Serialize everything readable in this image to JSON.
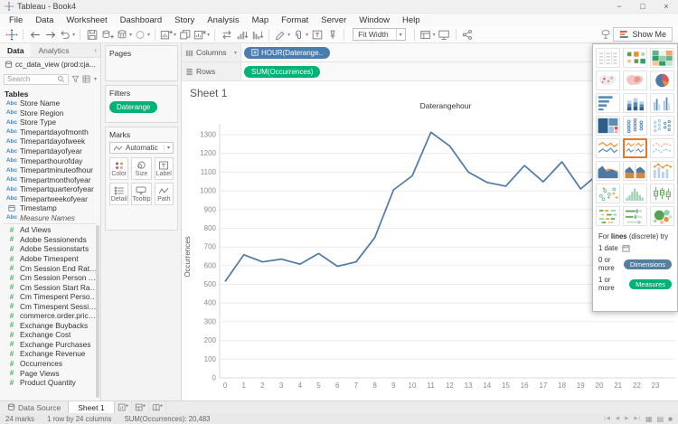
{
  "window": {
    "title": "Tableau - Book4",
    "controls": [
      {
        "name": "minimize",
        "glyph": "−"
      },
      {
        "name": "maximize",
        "glyph": "□"
      },
      {
        "name": "close",
        "glyph": "×"
      }
    ]
  },
  "glyphs": {
    "caret": "▾",
    "collapse": "‹"
  },
  "menu": {
    "items": [
      "File",
      "Data",
      "Worksheet",
      "Dashboard",
      "Story",
      "Analysis",
      "Map",
      "Format",
      "Server",
      "Window",
      "Help"
    ]
  },
  "toolbar": {
    "fit_label": "Fit Width",
    "show_me_label": "Show Me",
    "groups": [
      [
        {
          "name": "tableau-logo-button",
          "icon": "tableau-logo"
        }
      ],
      [
        {
          "name": "back-button",
          "icon": "back"
        },
        {
          "name": "forward-button",
          "icon": "forward"
        },
        {
          "name": "undo-button",
          "icon": "undo",
          "caret": true
        }
      ],
      [
        {
          "name": "save-button",
          "icon": "save"
        },
        {
          "name": "add-datasource-button",
          "icon": "add-datasource"
        },
        {
          "name": "datasource-button",
          "icon": "datasource",
          "caret": true
        },
        {
          "name": "auto-update-button",
          "icon": "auto-update",
          "caret": true
        }
      ],
      [
        {
          "name": "new-worksheet-button",
          "icon": "new-worksheet",
          "caret": true
        },
        {
          "name": "duplicate-sheet-button",
          "icon": "duplicate"
        },
        {
          "name": "clear-sheet-button",
          "icon": "clear-sheet",
          "caret": true
        }
      ],
      [
        {
          "name": "swap-axes-button",
          "icon": "swap-axes"
        },
        {
          "name": "sort-ascending-button",
          "icon": "sort-ascending"
        },
        {
          "name": "sort-descending-button",
          "icon": "sort-descending"
        }
      ],
      [
        {
          "name": "highlight-button",
          "icon": "highlight",
          "caret": true
        },
        {
          "name": "group-button",
          "icon": "group",
          "caret": true
        },
        {
          "name": "show-mark-labels-button",
          "icon": "show-mark-labels"
        },
        {
          "name": "fix-axes-button",
          "icon": "fix-axes"
        }
      ],
      [
        {
          "name": "fit-width-select",
          "type": "fit"
        }
      ],
      [
        {
          "name": "show-hide-cards-button",
          "icon": "show-hide-cards",
          "caret": true
        },
        {
          "name": "presentation-mode-button",
          "icon": "presentation"
        }
      ],
      [
        {
          "name": "share-button",
          "icon": "share"
        }
      ]
    ],
    "right": [
      {
        "name": "tooltip-balloon-button",
        "icon": "balloon"
      },
      {
        "name": "show-me-button",
        "type": "showme",
        "icon": "showme-bars"
      }
    ]
  },
  "data_pane": {
    "tabs": [
      {
        "label": "Data"
      },
      {
        "label": "Analytics"
      }
    ],
    "datasource": "cc_data_view (prod:cja...",
    "search_placeholder": "Search",
    "section_title": "Tables",
    "fields": [
      {
        "label": "Store Name",
        "type": "string"
      },
      {
        "label": "Store Region",
        "type": "string"
      },
      {
        "label": "Store Type",
        "type": "string"
      },
      {
        "label": "Timepartdayofmonth",
        "type": "string"
      },
      {
        "label": "Timepartdayofweek",
        "type": "string"
      },
      {
        "label": "Timepartdayofyear",
        "type": "string"
      },
      {
        "label": "Timeparthourofday",
        "type": "string"
      },
      {
        "label": "Timepartminuteofhour",
        "type": "string"
      },
      {
        "label": "Timepartmonthofyear",
        "type": "string"
      },
      {
        "label": "Timepartquarterofyear",
        "type": "string"
      },
      {
        "label": "Timepartweekofyear",
        "type": "string"
      },
      {
        "label": "Timestamp",
        "type": "datetime"
      },
      {
        "label": "Measure Names",
        "type": "string",
        "italic": true
      },
      {
        "label": "Ad Views",
        "type": "measure",
        "divider_before": true
      },
      {
        "label": "Adobe Sessionends",
        "type": "measure"
      },
      {
        "label": "Adobe Sessionstarts",
        "type": "measure"
      },
      {
        "label": "Adobe Timespent",
        "type": "measure"
      },
      {
        "label": "Cm Session End Rate ...",
        "type": "measure"
      },
      {
        "label": "Cm Session Person De...",
        "type": "measure"
      },
      {
        "label": "Cm Session Start Rate ...",
        "type": "measure"
      },
      {
        "label": "Cm Timespent Person ...",
        "type": "measure"
      },
      {
        "label": "Cm Timespent Session...",
        "type": "measure"
      },
      {
        "label": "commerce.order.price...",
        "type": "measure"
      },
      {
        "label": "Exchange Buybacks",
        "type": "measure"
      },
      {
        "label": "Exchange Cost",
        "type": "measure"
      },
      {
        "label": "Exchange Purchases",
        "type": "measure"
      },
      {
        "label": "Exchange Revenue",
        "type": "measure"
      },
      {
        "label": "Occurrences",
        "type": "measure"
      },
      {
        "label": "Page Views",
        "type": "measure"
      },
      {
        "label": "Product Quantity",
        "type": "measure"
      }
    ]
  },
  "cards": {
    "pages_label": "Pages",
    "filters_label": "Filters",
    "filter_pills": [
      "Daterange"
    ],
    "marks_label": "Marks",
    "mark_type": "Automatic",
    "mark_buttons": [
      {
        "label": "Color",
        "icon": "color"
      },
      {
        "label": "Size",
        "icon": "size"
      },
      {
        "label": "Label",
        "icon": "label"
      },
      {
        "label": "Detail",
        "icon": "detail"
      },
      {
        "label": "Tooltip",
        "icon": "tooltip"
      },
      {
        "label": "Path",
        "icon": "path"
      }
    ]
  },
  "shelves": {
    "columns_label": "Columns",
    "rows_label": "Rows",
    "columns_pills": [
      {
        "label": "HOUR(Daterange..",
        "color": "blue",
        "icon": "plus-box"
      }
    ],
    "rows_pills": [
      {
        "label": "SUM(Occurrences)",
        "color": "green"
      }
    ]
  },
  "sheet": {
    "title": "Sheet 1"
  },
  "chart_data": {
    "type": "line",
    "title": "Daterangehour",
    "xlabel": "",
    "ylabel": "Occurrences",
    "x": [
      0,
      1,
      2,
      3,
      4,
      5,
      6,
      7,
      8,
      9,
      10,
      11,
      12,
      13,
      14,
      15,
      16,
      17,
      18,
      19,
      20,
      21,
      22,
      23
    ],
    "values": [
      515,
      658,
      620,
      635,
      608,
      665,
      597,
      620,
      750,
      1005,
      1080,
      1313,
      1240,
      1100,
      1045,
      1025,
      1135,
      1048,
      1155,
      1010,
      1095,
      null,
      null,
      null
    ],
    "ylim": [
      0,
      1300
    ],
    "ytick_step": 100,
    "line_color": "#4e79a7",
    "grid": "horizontal",
    "legend": "none"
  },
  "show_me": {
    "thumbs": [
      "text-table",
      "heat-map",
      "highlight-table",
      "symbol-map",
      "filled-map",
      "pie-chart",
      "horizontal-bars",
      "stacked-bars",
      "side-by-side-bars",
      "treemap",
      "circle-views",
      "side-by-side-circles",
      "lines-continuous",
      "lines-discrete",
      "dual-lines",
      "area-continuous",
      "area-discrete",
      "dual-combination",
      "scatter-plot",
      "histogram",
      "box-and-whisker",
      "gantt",
      "bullet-graphs",
      "packed-bubbles"
    ],
    "selected": "lines-discrete",
    "hint_prefix": "For ",
    "hint_bold": "lines",
    "hint_suffix": " (discrete) try",
    "requirements": [
      {
        "text": "1 date",
        "icon": "calendar"
      },
      {
        "text": "0 or more",
        "pill": "Dimensions",
        "pill_color": "#54809e"
      },
      {
        "text": "1 or more",
        "pill": "Measures",
        "pill_color": "#00b276"
      }
    ]
  },
  "tabs_bar": {
    "datasource_tab": "Data Source",
    "sheet_tab": "Sheet 1"
  },
  "status_bar": {
    "marks": "24 marks",
    "size": "1 row by 24 columns",
    "aggregate": "SUM(Occurrences): 20,483",
    "nav": [
      "|◀",
      "◀",
      "▶",
      "▶|"
    ],
    "views": [
      {
        "name": "sheet-sorter-icon",
        "glyph": "▦"
      },
      {
        "name": "filmstrip-icon",
        "glyph": "▤"
      },
      {
        "name": "full-view-icon",
        "glyph": "■"
      }
    ]
  },
  "colors": {
    "pill_blue": "#4a7cb0",
    "pill_green": "#00b276",
    "line": "#4e79a7",
    "selection_orange": "#e8762d"
  }
}
